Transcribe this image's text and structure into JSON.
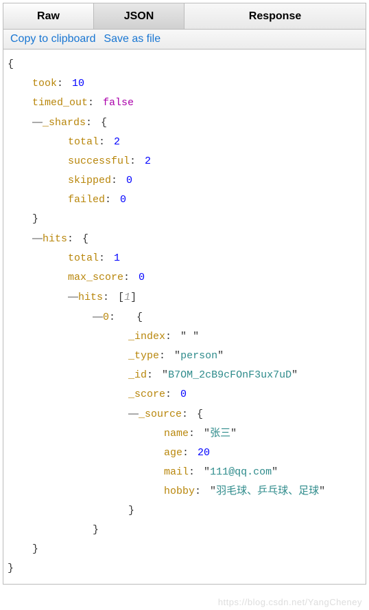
{
  "tabs": {
    "raw": "Raw",
    "json": "JSON",
    "response": "Response"
  },
  "actions": {
    "copy": "Copy to clipboard",
    "save": "Save as file"
  },
  "json": {
    "took_key": "took",
    "took": "10",
    "timed_out_key": "timed_out",
    "timed_out": "false",
    "shards_key": "_shards",
    "shards_total_key": "total",
    "shards_total": "2",
    "shards_successful_key": "successful",
    "shards_successful": "2",
    "shards_skipped_key": "skipped",
    "shards_skipped": "0",
    "shards_failed_key": "failed",
    "shards_failed": "0",
    "hits_key": "hits",
    "hits_total_key": "total",
    "hits_total": "1",
    "max_score_key": "max_score",
    "max_score": "0",
    "hits_arr_key": "hits",
    "hits_arr_count": "1",
    "item0_key": "0",
    "index_key": "_index",
    "index_val": "      ",
    "type_key": "_type",
    "type_val": "person",
    "id_key": "_id",
    "id_val": "B7OM_2cB9cFOnF3ux7uD",
    "score_key": "_score",
    "score_val": "0",
    "source_key": "_source",
    "name_key": "name",
    "name_val": "张三",
    "age_key": "age",
    "age_val": "20",
    "mail_key": "mail",
    "mail_val": "111@qq.com",
    "hobby_key": "hobby",
    "hobby_val": "羽毛球、乒乓球、足球"
  },
  "watermark": "https://blog.csdn.net/YangCheney"
}
